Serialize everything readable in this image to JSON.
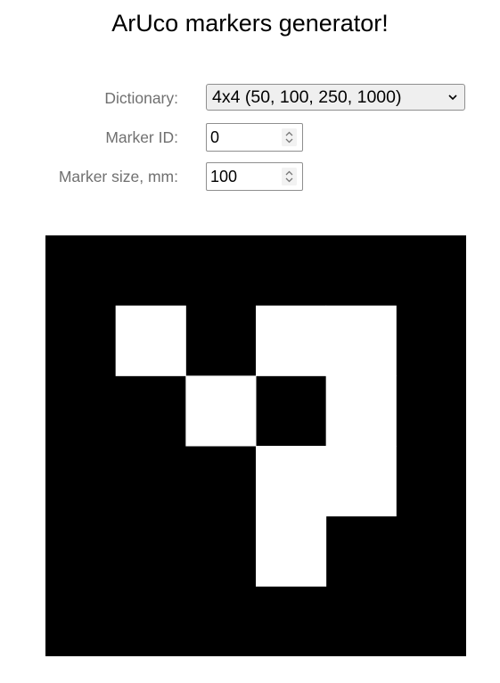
{
  "page": {
    "title": "ArUco markers generator!"
  },
  "form": {
    "dictionary": {
      "label": "Dictionary:",
      "selected": "4x4 (50, 100, 250, 1000)"
    },
    "marker_id": {
      "label": "Marker ID:",
      "value": "0"
    },
    "marker_size": {
      "label": "Marker size, mm:",
      "value": "100"
    }
  },
  "marker": {
    "bits": [
      [
        1,
        0,
        1,
        1
      ],
      [
        0,
        1,
        0,
        1
      ],
      [
        0,
        0,
        1,
        1
      ],
      [
        0,
        0,
        1,
        0
      ]
    ],
    "colors": {
      "black": "#000000",
      "white": "#ffffff"
    }
  }
}
